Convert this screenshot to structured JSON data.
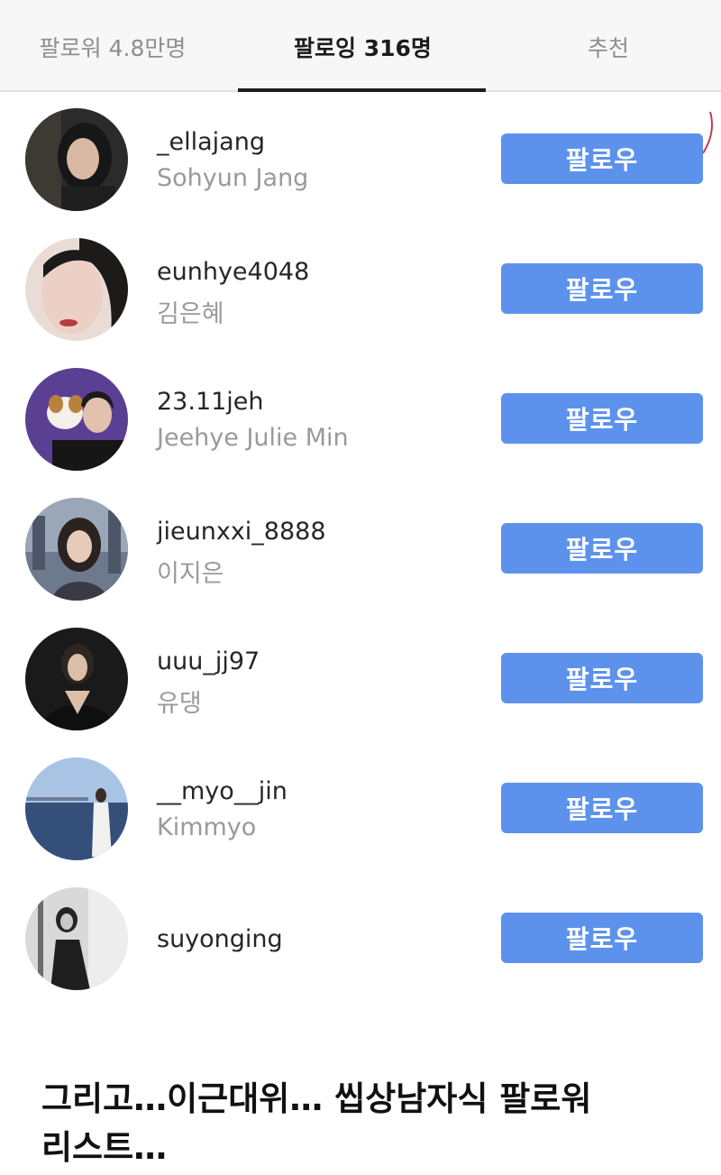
{
  "tabs": {
    "followers": "팔로워 4.8만명",
    "following": "팔로잉 316명",
    "suggested": "추천"
  },
  "colors": {
    "follow_button": "#5d92ec",
    "active_tab": "#1c1c1c",
    "inactive_tab": "#8e8e8e"
  },
  "users": [
    {
      "username": "_ellajang",
      "name": "Sohyun Jang",
      "button": "팔로우"
    },
    {
      "username": "eunhye4048",
      "name": "김은혜",
      "button": "팔로우"
    },
    {
      "username": "23.11jeh",
      "name": "Jeehye Julie Min",
      "button": "팔로우"
    },
    {
      "username": "jieunxxi_8888",
      "name": "이지은",
      "button": "팔로우"
    },
    {
      "username": "uuu_jj97",
      "name": "유댕",
      "button": "팔로우"
    },
    {
      "username": "__myo__jin",
      "name": "Kimmyo",
      "button": "팔로우"
    },
    {
      "username": "suyonging",
      "name": "",
      "button": "팔로우"
    }
  ],
  "caption": {
    "line1": "그리고…이근대위… 씹상남자식 팔로워",
    "line2": "리스트…"
  }
}
